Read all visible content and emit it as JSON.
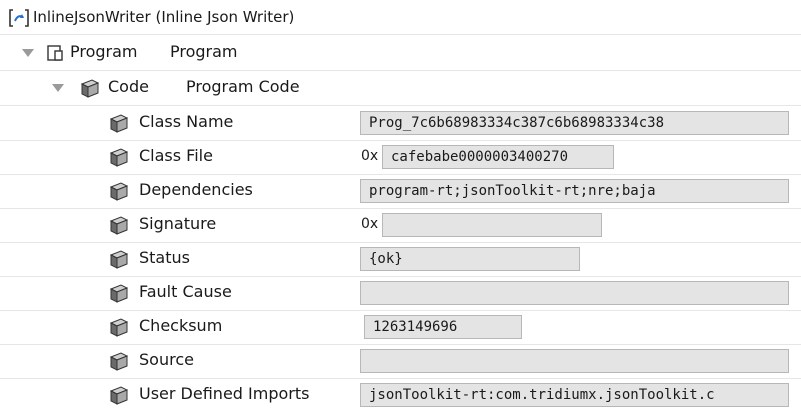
{
  "header": {
    "title": "InlineJsonWriter  (Inline Json Writer)"
  },
  "tree": {
    "program": {
      "name": "Program",
      "display": "Program"
    },
    "code": {
      "name": "Code",
      "display": "Program Code"
    }
  },
  "props": [
    {
      "label": "Class Name",
      "value": "Prog_7c6b68983334c387c6b68983334c38"
    },
    {
      "label": "Class File",
      "prefix": "0x",
      "value": "cafebabe0000003400270"
    },
    {
      "label": "Dependencies",
      "value": "program-rt;jsonToolkit-rt;nre;baja"
    },
    {
      "label": "Signature",
      "prefix": "0x",
      "value": ""
    },
    {
      "label": "Status",
      "value": "{ok}"
    },
    {
      "label": "Fault Cause",
      "value": ""
    },
    {
      "label": "Checksum",
      "value": "1263149696"
    },
    {
      "label": "Source",
      "value": ""
    },
    {
      "label": "User Defined Imports",
      "value": "jsonToolkit-rt:com.tridiumx.jsonToolkit.c"
    }
  ]
}
